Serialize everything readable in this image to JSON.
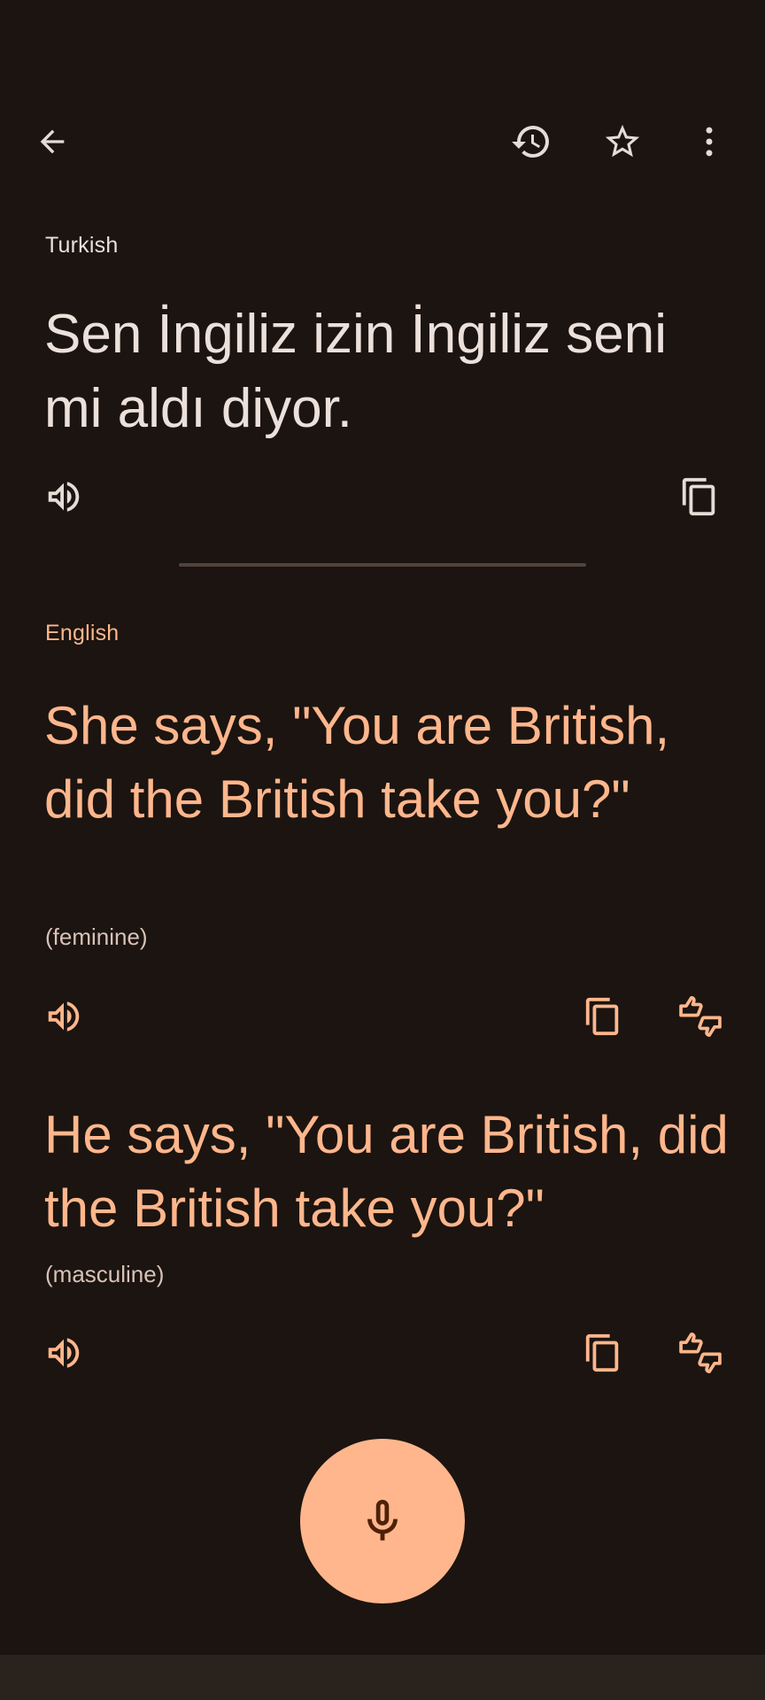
{
  "source": {
    "language": "Turkish",
    "text": "Sen İngiliz izin İngiliz seni mi aldı diyor."
  },
  "target": {
    "language": "English",
    "translations": [
      {
        "text": "She says, \"You are British, did the British take you?\"",
        "gender": "(feminine)"
      },
      {
        "text": "He says, \"You are British, did the British take you?\"",
        "gender": "(masculine)"
      }
    ]
  },
  "icons": {
    "back": "arrow-left-icon",
    "history": "history-icon",
    "favorite": "star-outline-icon",
    "more": "more-vert-icon",
    "speak": "volume-icon",
    "copy": "copy-icon",
    "feedback": "thumbs-up-down-icon",
    "mic": "mic-icon"
  },
  "colors": {
    "background": "#1b1410",
    "source_text": "#ece0da",
    "accent": "#ffb68c",
    "divider": "#53433a",
    "mic_fab": "#ffb68c",
    "mic_icon": "#4f2108"
  }
}
